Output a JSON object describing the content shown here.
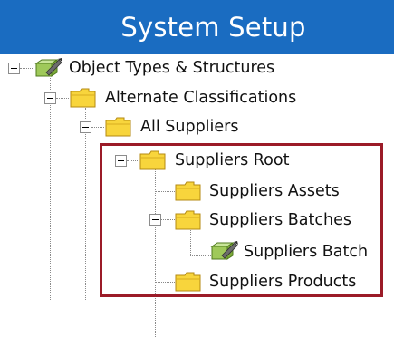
{
  "header": {
    "title": "System Setup"
  },
  "tree": {
    "nodes": [
      {
        "label": "Object Types & Structures",
        "icon": "object-type-icon"
      },
      {
        "label": "Alternate Classifications",
        "icon": "folder-icon"
      },
      {
        "label": "All Suppliers",
        "icon": "folder-icon"
      },
      {
        "label": "Suppliers Root",
        "icon": "folder-icon"
      },
      {
        "label": "Suppliers Assets",
        "icon": "folder-icon"
      },
      {
        "label": "Suppliers Batches",
        "icon": "folder-icon"
      },
      {
        "label": "Suppliers Batch",
        "icon": "object-type-icon"
      },
      {
        "label": "Suppliers Products",
        "icon": "folder-icon"
      }
    ]
  },
  "colors": {
    "header_bg": "#1a6cc1",
    "highlight_border": "#9b1b28",
    "folder_fill": "#f8d53c"
  }
}
